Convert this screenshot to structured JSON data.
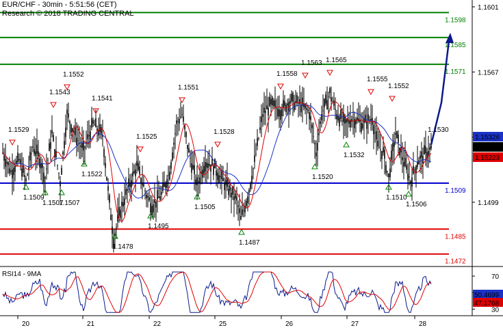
{
  "chart_data": [
    {
      "type": "candlestick",
      "symbol_line": "EUR/CHF - 30min - 5:51:56 (CET)",
      "copyright": "Research © 2018 TRADING CENTRAL",
      "x_ticks": [
        "20",
        "21",
        "22",
        "25",
        "26",
        "27",
        "28"
      ],
      "y_ticks": [
        "1.1601",
        "1.1567",
        "1.1533",
        "1.1499"
      ],
      "ylim": [
        1.1465,
        1.1607
      ],
      "price_tags": [
        {
          "label": "1.15326",
          "value": 1.15326,
          "color": "#1a32c8"
        },
        {
          "label": "1.15269",
          "value": 1.15269,
          "color": "#000000"
        },
        {
          "label": "1.15223",
          "value": 1.15223,
          "color": "#e00000"
        }
      ],
      "levels": [
        {
          "label": "1.1598",
          "value": 1.1598,
          "color": "#008000"
        },
        {
          "label": "1.1585",
          "value": 1.1585,
          "color": "#008000"
        },
        {
          "label": "1.1571",
          "value": 1.1571,
          "color": "#008000"
        },
        {
          "label": "1.1509",
          "value": 1.1509,
          "color": "#0000cc"
        },
        {
          "label": "1.1485",
          "value": 1.1485,
          "color": "#e00000"
        },
        {
          "label": "1.1472",
          "value": 1.1472,
          "color": "#e00000"
        }
      ],
      "swing_highs": [
        "1.1529",
        "1.1543",
        "1.1552",
        "1.1541",
        "1.1525",
        "1.1551",
        "1.1528",
        "1.1558",
        "1.1563",
        "1.1565",
        "1.1555",
        "1.1552"
      ],
      "swing_lows": [
        "1.1509",
        "1.1507",
        "1.1507",
        "1.1522",
        "1.1478",
        "1.1495",
        "1.1505",
        "1.1487",
        "1.1520",
        "1.1532",
        "1.1510",
        "1.1506"
      ],
      "forecast_label": "1.1530",
      "close": 1.15269,
      "series": [
        {
          "name": "",
          "color": "#1a32c8"
        },
        {
          "name": "",
          "color": "#e00000"
        }
      ]
    },
    {
      "type": "line",
      "title": "RSI14 - 9MA",
      "y_ticks": [
        "70",
        "50",
        "30"
      ],
      "ylim": [
        22,
        80
      ],
      "value_tags": [
        {
          "label": "50.4699",
          "value": 50.4699,
          "color": "#1a32c8"
        },
        {
          "label": "47.1768",
          "value": 47.1768,
          "color": "#e00000"
        }
      ]
    }
  ]
}
